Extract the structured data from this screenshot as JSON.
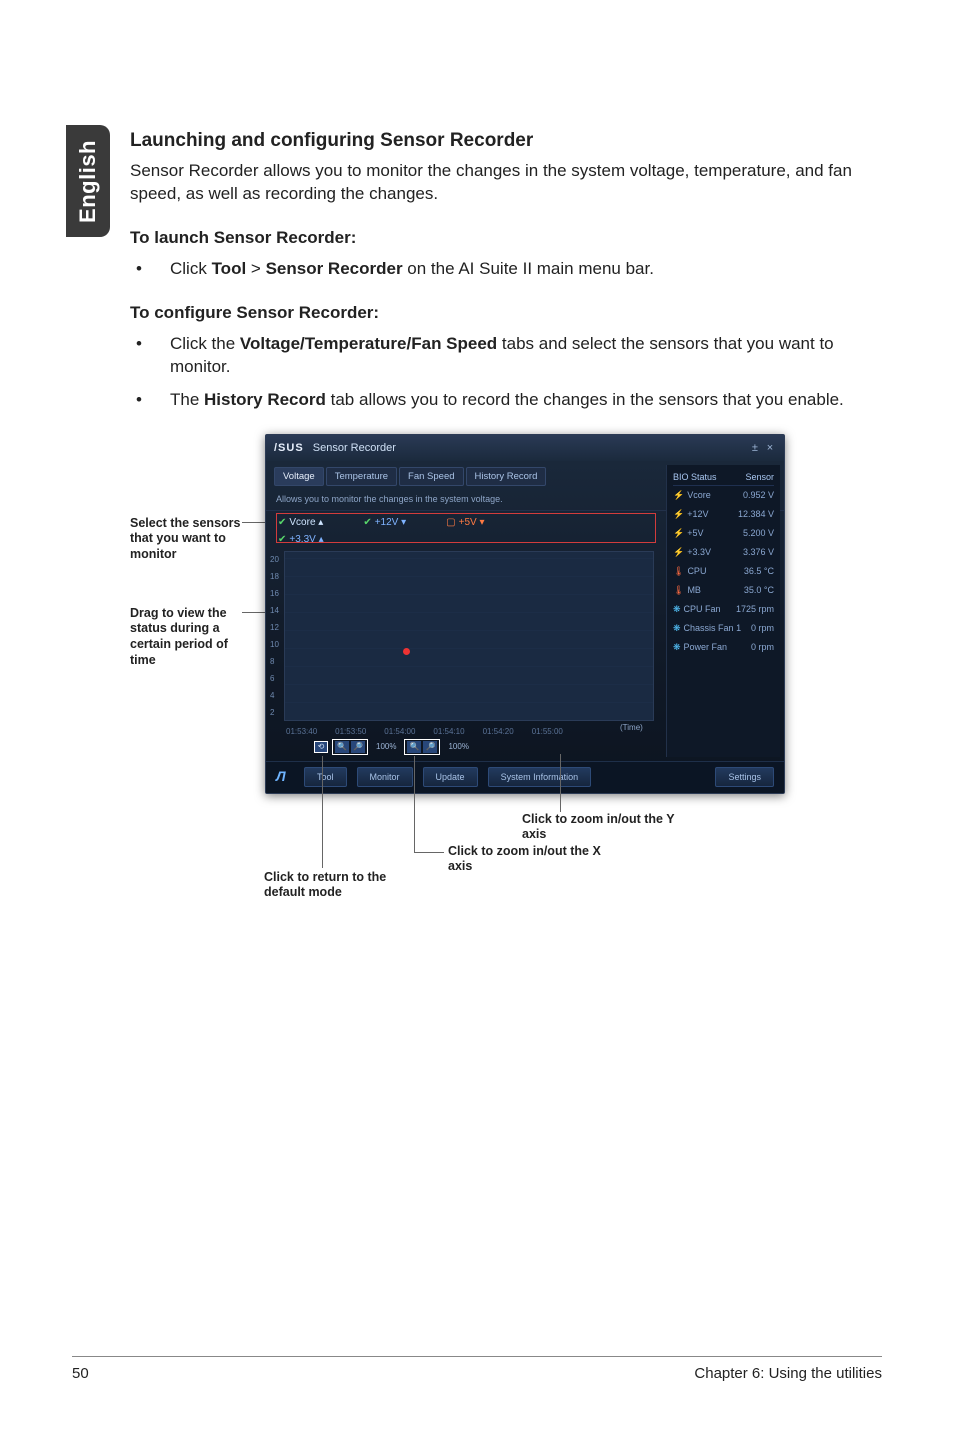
{
  "sideTab": "English",
  "heading": "Launching and configuring Sensor Recorder",
  "intro": "Sensor Recorder allows you to monitor the changes in the system voltage, temperature, and fan speed, as well as recording the changes.",
  "launchHead": "To launch Sensor Recorder:",
  "launchBullets": [
    {
      "pre": "Click ",
      "b1": "Tool",
      "mid": " > ",
      "b2": "Sensor Recorder",
      "post": " on the AI Suite II main menu bar."
    }
  ],
  "configHead": "To configure Sensor Recorder:",
  "configBullets": [
    {
      "pre": "Click the ",
      "b1": "Voltage/Temperature/Fan Speed",
      "post": " tabs and select the sensors that you want to monitor."
    },
    {
      "pre": "The ",
      "b1": "History Record",
      "post": " tab allows you to record the changes in the sensors that you enable."
    }
  ],
  "labels": {
    "selectSensors": "Select the sensors that you want to monitor",
    "dragView": "Drag to view the status during a certain period of time",
    "zoomY": "Click to zoom in/out the Y axis",
    "zoomX": "Click to zoom in/out the X axis",
    "returnDefault": "Click to return to the default mode"
  },
  "window": {
    "title": "Sensor Recorder",
    "brand": "/SUS",
    "tabs": [
      "Voltage",
      "Temperature",
      "Fan Speed",
      "History Record"
    ],
    "desc": "Allows you to monitor the changes in the system voltage.",
    "subtabs": [
      {
        "label": "Vcore",
        "checked": true
      },
      {
        "label": "+12V",
        "checked": true
      },
      {
        "label": "+5V",
        "checked": false
      }
    ],
    "extraRow": "+3.3V",
    "yvals": [
      "20",
      "18",
      "16",
      "14",
      "12",
      "10",
      "8",
      "6",
      "4",
      "2"
    ],
    "times": [
      "01:53:40",
      "01:53:50",
      "01:54:00",
      "01:54:10",
      "01:54:20",
      "01:55:00"
    ],
    "timeLabel": "(Time)",
    "zoomVals": [
      "100%",
      "100%"
    ],
    "sideHeader": {
      "left": "BIO Status",
      "right": "Sensor"
    },
    "sideRows": [
      {
        "icon": "bolt",
        "name": "Vcore",
        "val": "0.952 V"
      },
      {
        "icon": "bolt",
        "name": "+12V",
        "val": "12.384 V"
      },
      {
        "icon": "bolt",
        "name": "+5V",
        "val": "5.200 V"
      },
      {
        "icon": "bolt",
        "name": "+3.3V",
        "val": "3.376 V"
      },
      {
        "icon": "temp",
        "name": "CPU",
        "val": "36.5 °C"
      },
      {
        "icon": "temp",
        "name": "MB",
        "val": "35.0 °C"
      },
      {
        "icon": "fan",
        "name": "CPU Fan",
        "val": "1725 rpm"
      },
      {
        "icon": "fan",
        "name": "Chassis Fan 1",
        "val": "0 rpm"
      },
      {
        "icon": "fan",
        "name": "Power Fan",
        "val": "0 rpm"
      }
    ],
    "bottom": [
      "Tool",
      "Monitor",
      "Update",
      "System Information",
      "Settings"
    ]
  },
  "footer": {
    "page": "50",
    "chapter": "Chapter 6: Using the utilities"
  }
}
